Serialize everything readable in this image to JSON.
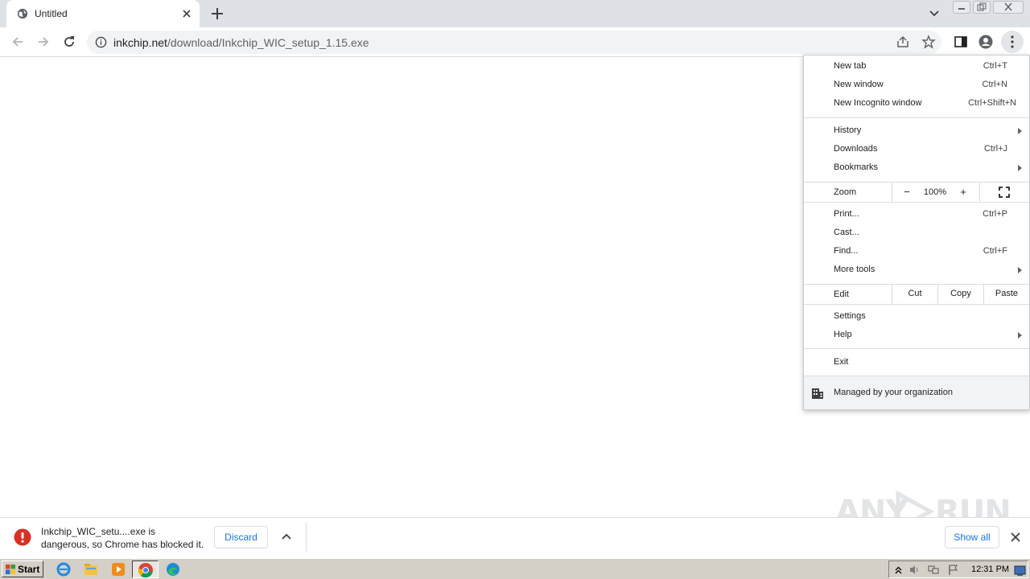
{
  "tab": {
    "title": "Untitled"
  },
  "omnibox": {
    "host": "inkchip.net",
    "path": "/download/Inkchip_WIC_setup_1.15.exe"
  },
  "menu": {
    "items_group1": [
      {
        "label": "New tab",
        "shortcut": "Ctrl+T"
      },
      {
        "label": "New window",
        "shortcut": "Ctrl+N"
      },
      {
        "label": "New Incognito window",
        "shortcut": "Ctrl+Shift+N"
      }
    ],
    "items_group2": [
      {
        "label": "History",
        "shortcut": ""
      },
      {
        "label": "Downloads",
        "shortcut": "Ctrl+J"
      },
      {
        "label": "Bookmarks",
        "shortcut": ""
      }
    ],
    "zoom": {
      "label": "Zoom",
      "minus": "−",
      "value": "100%",
      "plus": "+"
    },
    "items_group3": [
      {
        "label": "Print...",
        "shortcut": "Ctrl+P"
      },
      {
        "label": "Cast...",
        "shortcut": ""
      },
      {
        "label": "Find...",
        "shortcut": "Ctrl+F"
      },
      {
        "label": "More tools",
        "shortcut": ""
      }
    ],
    "edit": {
      "label": "Edit",
      "cut": "Cut",
      "copy": "Copy",
      "paste": "Paste"
    },
    "items_group4": [
      {
        "label": "Settings",
        "shortcut": ""
      },
      {
        "label": "Help",
        "shortcut": ""
      }
    ],
    "exit": "Exit",
    "managed": "Managed by your organization"
  },
  "download": {
    "line1": "Inkchip_WIC_setu....exe is",
    "line2": "dangerous, so Chrome has blocked it.",
    "discard": "Discard",
    "show_all": "Show all"
  },
  "watermark": {
    "left": "ANY",
    "right": "RUN"
  },
  "taskbar": {
    "start": "Start",
    "clock": "12:31 PM"
  },
  "colors": {
    "accent": "#1a73e8",
    "danger": "#d93025",
    "tabstrip": "#dee1e6",
    "taskbar": "#d4d0c8"
  }
}
